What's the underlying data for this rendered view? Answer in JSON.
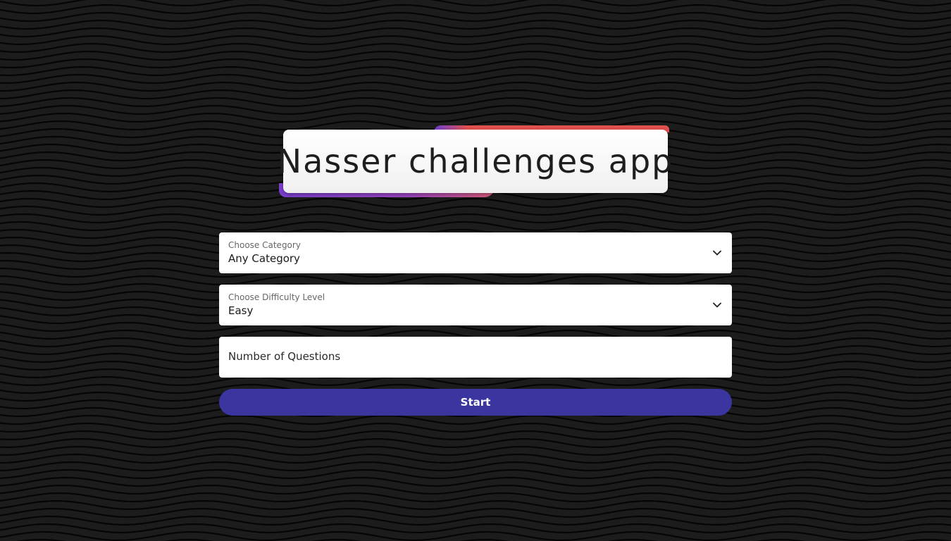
{
  "app": {
    "title": "Nasser challenges app"
  },
  "form": {
    "category": {
      "label": "Choose Category",
      "value": "Any Category"
    },
    "difficulty": {
      "label": "Choose Difficulty Level",
      "value": "Easy"
    },
    "questions": {
      "placeholder": "Number of Questions"
    },
    "start_label": "Start"
  },
  "colors": {
    "background": "#1c1c1c",
    "wave_line": "#050505",
    "button": "#3b35a0",
    "accent_red": "#e0504d",
    "accent_purple": "#7a3fd0"
  },
  "icons": {
    "dropdown": "chevron-down-icon"
  }
}
